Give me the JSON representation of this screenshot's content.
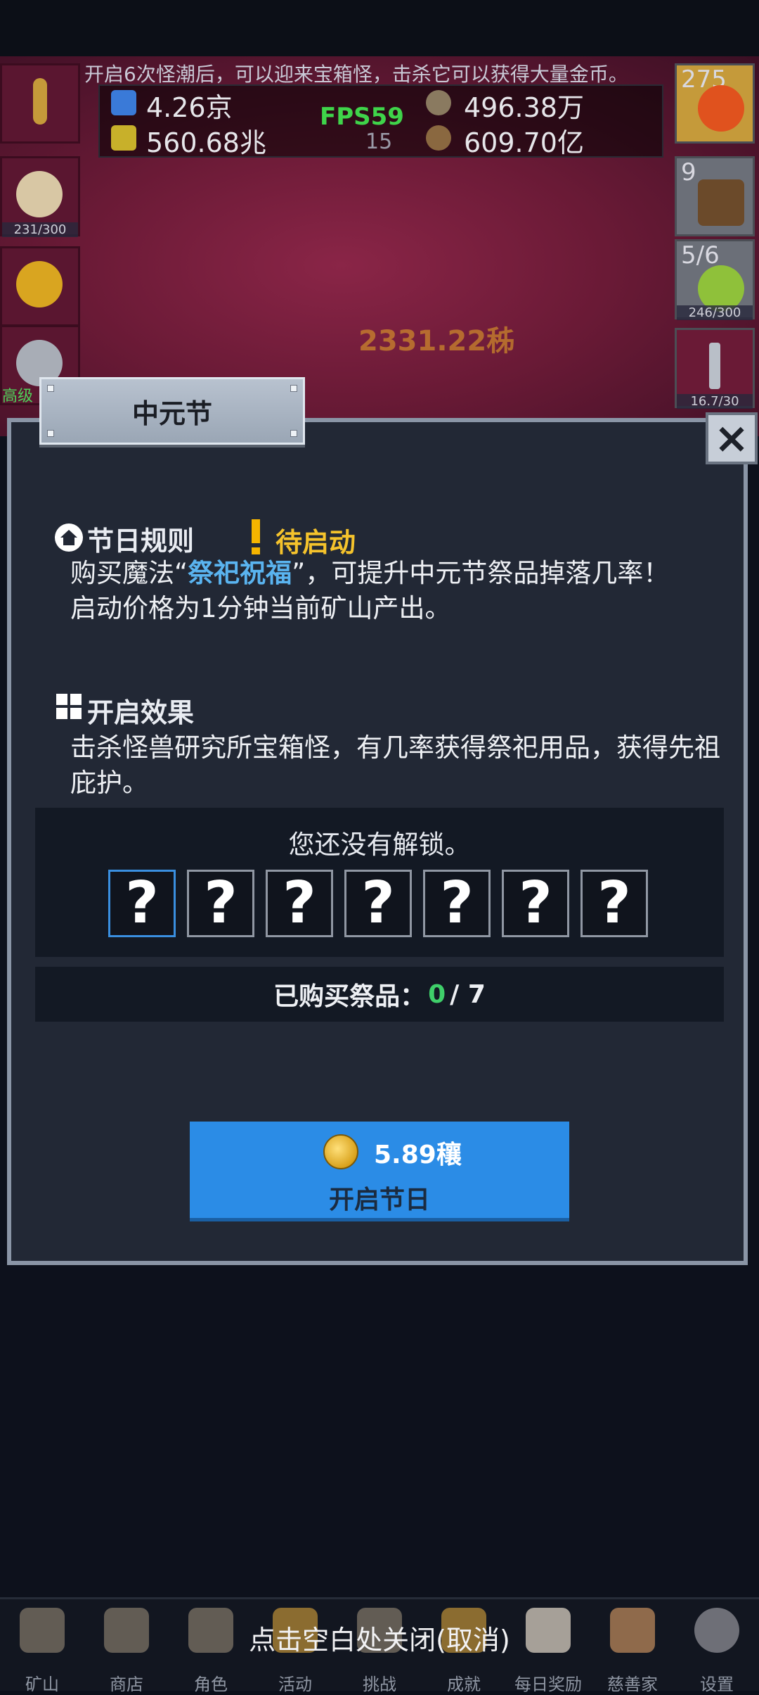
{
  "banner": "开启6次怪潮后，可以迎来宝箱怪，击杀它可以获得大量金币。",
  "resources": {
    "r1": "4.26京",
    "r2": "560.68兆",
    "r3": "496.38万",
    "r4": "609.70亿",
    "fps": "FPS59",
    "fps_sub": "15"
  },
  "side_left": {
    "slot2_label": "231/300",
    "slot4_label": "高级"
  },
  "side_right": {
    "slot1_num": "275",
    "slot2_num": "9",
    "slot3_num": "5/6",
    "slot3_label": "246/300",
    "slot4_label": "16.7/30"
  },
  "battle_text": "2331.22秭",
  "modal": {
    "title": "中元节",
    "close_icon": "close-x",
    "rules_heading": "节日规则",
    "status": "待启动",
    "rules_line1_pre": "购买魔法“",
    "rules_line1_hl": "祭祀祝福",
    "rules_line1_post": "”，可提升中元节祭品掉落几率！",
    "rules_line2": "启动价格为1分钟当前矿山产出。",
    "effect_heading": "开启效果",
    "effect_text": "击杀怪兽研究所宝箱怪，有几率获得祭祀用品，获得先祖庇护。",
    "unlock_text": "您还没有解锁。",
    "slots": [
      "?",
      "?",
      "?",
      "?",
      "?",
      "?",
      "?"
    ],
    "bought_label": "已购买祭品：",
    "bought_current": "0",
    "bought_total": "/ 7",
    "price": "5.89穰",
    "start_label": "开启节日"
  },
  "dismiss_text": "点击空白处关闭(取消)",
  "nav": [
    "矿山",
    "商店",
    "角色",
    "活动",
    "挑战",
    "成就",
    "每日奖励",
    "慈善家",
    "设置"
  ],
  "colors": {
    "accent_blue": "#2b8ce6",
    "status_yellow": "#f5c32c",
    "highlight_blue": "#5ab4f0",
    "count_green": "#3fcf6a",
    "fps_green": "#3fd44a"
  }
}
